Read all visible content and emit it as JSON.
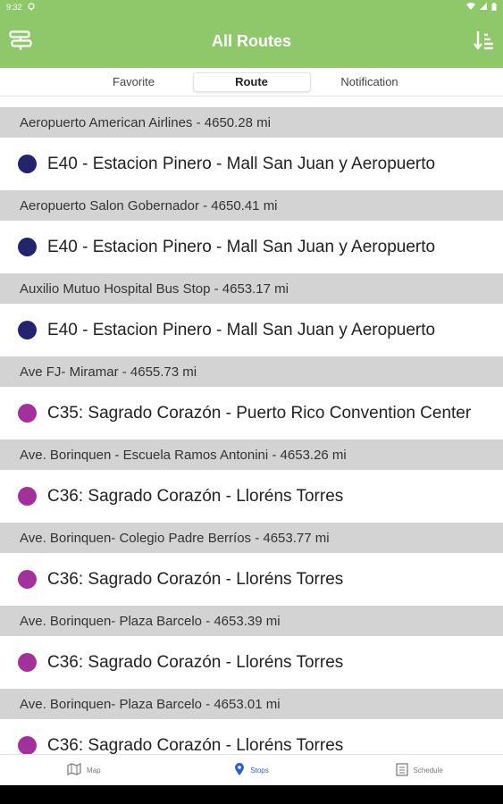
{
  "status": {
    "time": "9:32"
  },
  "appbar": {
    "title": "All Routes"
  },
  "tabs": [
    {
      "label": "Favorite",
      "active": false
    },
    {
      "label": "Route",
      "active": true
    },
    {
      "label": "Notification",
      "active": false
    }
  ],
  "colors": {
    "accent": "#8fc86b",
    "dot_e40": "#24236e",
    "dot_c35_c36": "#a3319b",
    "nav_active": "#2a62c9"
  },
  "list": [
    {
      "stop": "Aeropuerto American Airlines - 4650.28 mi",
      "route": "E40 - Estacion Pinero - Mall San Juan y Aeropuerto",
      "color": "#24236e"
    },
    {
      "stop": "Aeropuerto Salon Gobernador - 4650.41 mi",
      "route": "E40 - Estacion Pinero - Mall San Juan y Aeropuerto",
      "color": "#24236e"
    },
    {
      "stop": "Auxilio Mutuo Hospital Bus Stop - 4653.17 mi",
      "route": "E40 - Estacion Pinero - Mall San Juan y Aeropuerto",
      "color": "#24236e"
    },
    {
      "stop": "Ave FJ- Miramar - 4655.73 mi",
      "route": "C35: Sagrado Corazón - Puerto Rico Convention Center",
      "color": "#a3319b"
    },
    {
      "stop": "Ave. Borinquen - Escuela Ramos Antonini - 4653.26 mi",
      "route": "C36: Sagrado Corazón - Lloréns Torres",
      "color": "#a3319b"
    },
    {
      "stop": "Ave. Borinquen- Colegio Padre Berríos - 4653.77 mi",
      "route": "C36: Sagrado Corazón - Lloréns Torres",
      "color": "#a3319b"
    },
    {
      "stop": "Ave. Borinquen- Plaza Barcelo - 4653.39 mi",
      "route": "C36: Sagrado Corazón - Lloréns Torres",
      "color": "#a3319b"
    },
    {
      "stop": "Ave. Borinquen- Plaza Barcelo - 4653.01 mi",
      "route": "C36: Sagrado Corazón - Lloréns Torres",
      "color": "#a3319b"
    }
  ],
  "bottomnav": [
    {
      "label": "Map",
      "icon": "map-icon",
      "active": false
    },
    {
      "label": "Stops",
      "icon": "location-pin-icon",
      "active": true
    },
    {
      "label": "Schedule",
      "icon": "schedule-icon",
      "active": false
    }
  ]
}
